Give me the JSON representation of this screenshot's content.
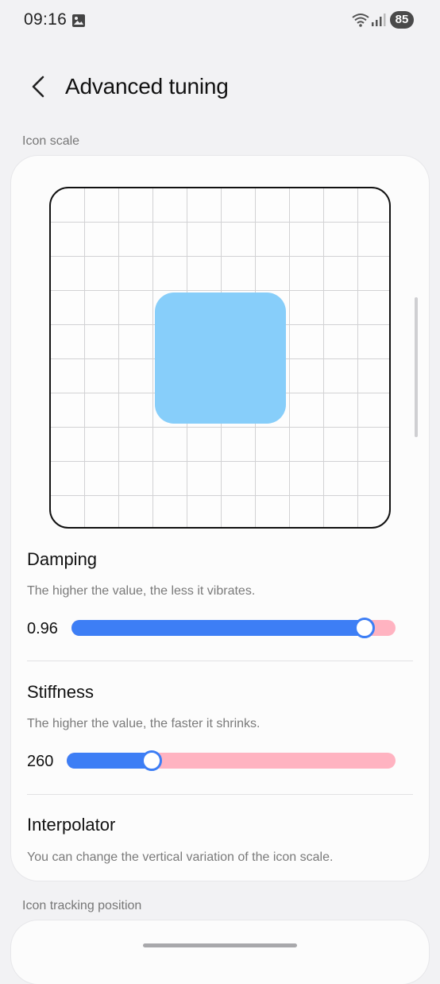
{
  "status": {
    "time": "09:16",
    "battery": "85"
  },
  "header": {
    "title": "Advanced tuning"
  },
  "sections": {
    "icon_scale": "Icon scale",
    "icon_tracking": "Icon tracking position"
  },
  "damping": {
    "title": "Damping",
    "description": "The higher the value, the less it vibrates.",
    "value": "0.96",
    "fraction": 0.905
  },
  "stiffness": {
    "title": "Stiffness",
    "description": "The higher the value, the faster it shrinks.",
    "value": "260",
    "fraction": 0.258
  },
  "interpolator": {
    "title": "Interpolator",
    "description": "You can change the vertical variation of the icon scale."
  },
  "colors": {
    "slider_active": "#3d7ef5",
    "slider_inactive": "#ffb3c1",
    "preview_icon": "#87cefa"
  }
}
